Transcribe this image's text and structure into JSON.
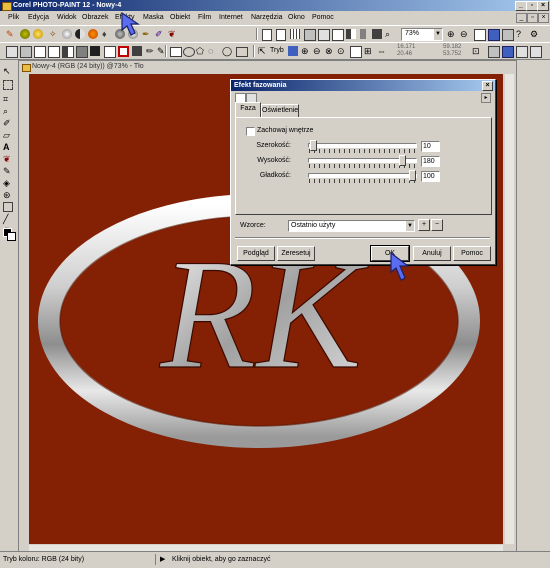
{
  "app": {
    "title": "Corel PHOTO-PAINT 12 - Nowy-4"
  },
  "menu": [
    "Plik",
    "Edycja",
    "Widok",
    "Obrazek",
    "Efekty",
    "Maska",
    "Obiekt",
    "Film",
    "Internet",
    "Narzędzia",
    "Okno",
    "Pomoc"
  ],
  "toolbar": {
    "zoom_value": "73%",
    "mode_label": "Tryb",
    "coord_a1": "16.171",
    "coord_a2": "20.46",
    "coord_b1": "59.182",
    "coord_b2": "53.752"
  },
  "document": {
    "title": "Nowy-4 (RGB (24 bity)) @73% - Tło",
    "image_text": "RK"
  },
  "dialog": {
    "title": "Efekt fazowania",
    "tabs": [
      "Faza",
      "Oświetlenie"
    ],
    "checkbox_label": "Zachowaj wnętrze",
    "sliders": [
      {
        "label": "Szerokość:",
        "value": "10",
        "level": 0.02
      },
      {
        "label": "Wysokość:",
        "value": "180",
        "level": 0.9
      },
      {
        "label": "Gładkość:",
        "value": "100",
        "level": 1.0
      }
    ],
    "preset_label": "Wzorce:",
    "preset_value": "Ostatnio użyty",
    "buttons": {
      "preview": "Podgląd",
      "reset": "Zeresetuj",
      "ok": "OK",
      "cancel": "Anuluj",
      "help": "Pomoc"
    }
  },
  "status": {
    "color_mode": "Tryb koloru: RGB (24 bity)",
    "hint": "Kliknij obiekt, aby go zaznaczyć"
  },
  "colors": {
    "canvas": "#842003",
    "accent": "#0a246a",
    "cursor": "#5a6cf0"
  }
}
